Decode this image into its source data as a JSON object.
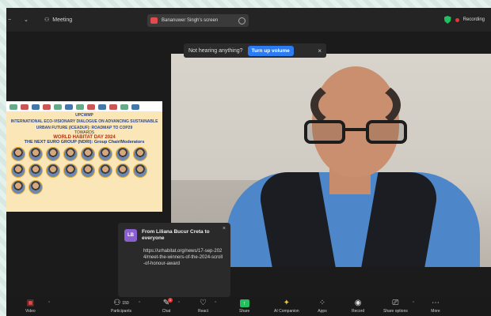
{
  "titlebar": {
    "meeting_label": "Meeting",
    "share_label": "Bananuwer Singh's screen",
    "recording_label": "Recording"
  },
  "notice": {
    "text": "Not hearing anything?",
    "button": "Turn up volume",
    "close": "×"
  },
  "poster": {
    "title_line1": "UPCWMP",
    "title_line2": "INTERNATIONAL ECO-VISIONARY DIALOGUE ON ADVANCING SUSTAINABLE",
    "title_line3": "URBAN FUTURE (ICEADUF): ROADMAP TO COP29",
    "sub": "TOWARDS",
    "date": "WORLD HABITAT DAY 2024",
    "panel": "THE NEXT EURO GROUP (NDRI): Group Chair/Moderators"
  },
  "chat": {
    "avatar_initials": "LB",
    "from": "From Liliana Bucur Creta to everyone",
    "message": "https://urhabitat.org/news/17-sep-2024/meet-the-winners-of-the-2024-scroll-of-honour-award",
    "close": "×"
  },
  "toolbar": {
    "video": "Video",
    "participants": "Participants",
    "participants_count": "150",
    "chat": "Chat",
    "chat_badge": "1",
    "react": "React",
    "share": "Share",
    "ai_companion": "AI Companion",
    "apps": "Apps",
    "record": "Record",
    "share_options": "Share options",
    "more": "More"
  },
  "colors": {
    "accent": "#2d7bf0",
    "share_green": "#1fc15e",
    "stop_red": "#e04848"
  }
}
